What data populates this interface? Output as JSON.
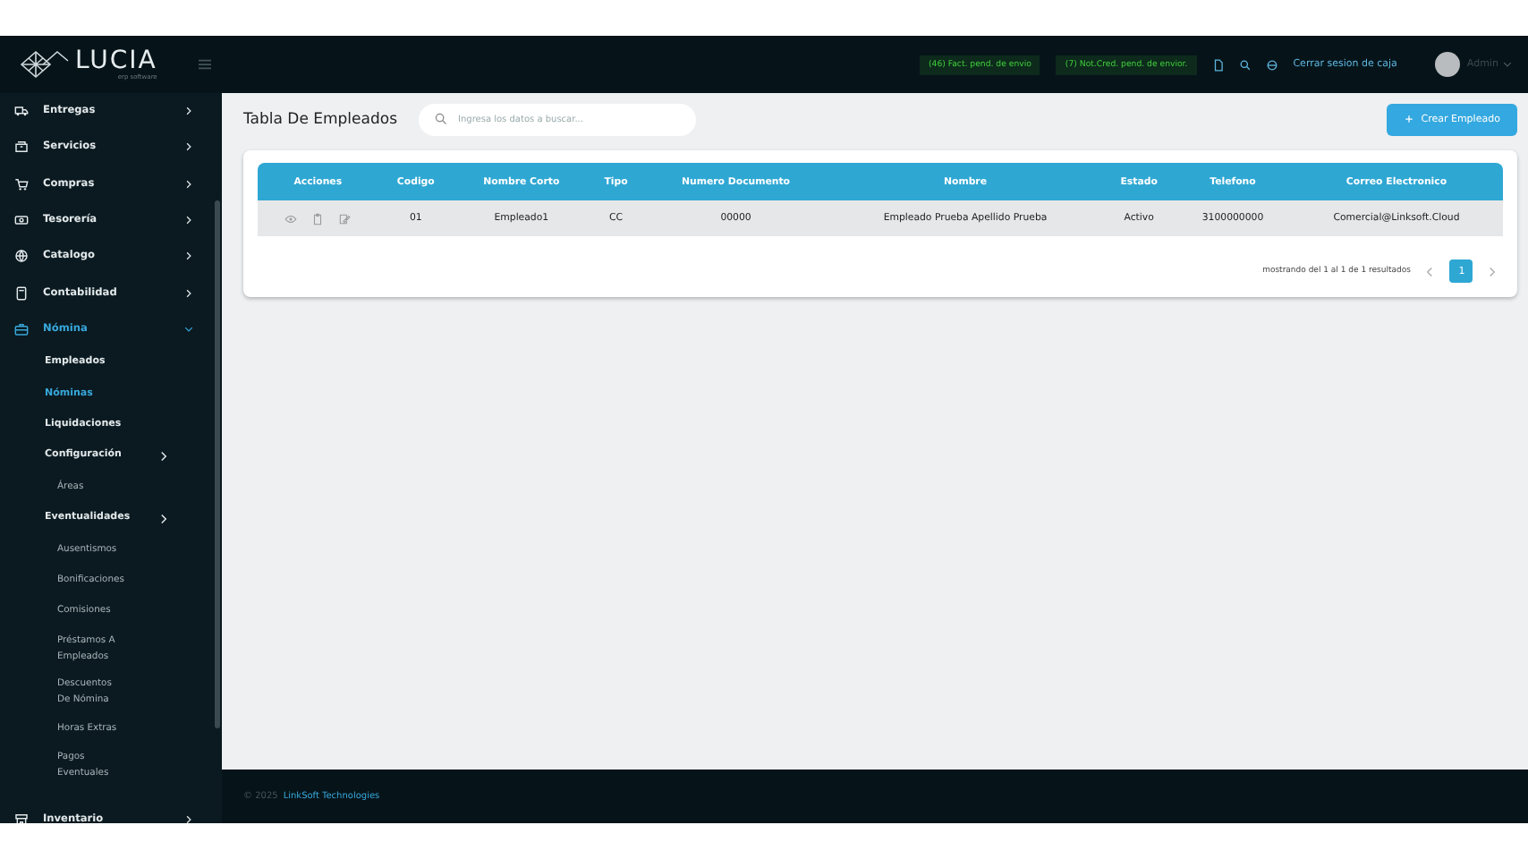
{
  "logo": {
    "name": "LUCIA",
    "tagline": "erp software"
  },
  "topbar": {
    "badges": [
      "(46) Fact. pend. de envio",
      "(7) Not.Cred. pend. de envior."
    ],
    "link": "Cerrar sesion de caja",
    "user": "Admin"
  },
  "sidebar": {
    "items": [
      {
        "label": "Entregas",
        "expanded": false,
        "selected": false
      },
      {
        "label": "Servicios",
        "expanded": false,
        "selected": false
      },
      {
        "label": "Compras",
        "expanded": false,
        "selected": false
      },
      {
        "label": "Tesorería",
        "expanded": false,
        "selected": false
      },
      {
        "label": "Catalogo",
        "expanded": false,
        "selected": false
      },
      {
        "label": "Contabilidad",
        "expanded": false,
        "selected": false
      },
      {
        "label": "Nómina",
        "expanded": true,
        "selected": true,
        "children": [
          {
            "label": "Empleados",
            "selected": false
          },
          {
            "label": "Nóminas",
            "selected": true
          },
          {
            "label": "Liquidaciones",
            "selected": false
          },
          {
            "label": "Configuración",
            "selected": false,
            "children": [
              {
                "label": "Áreas",
                "selected": false
              }
            ]
          },
          {
            "label": "Eventualidades",
            "selected": false,
            "children": [
              {
                "label": "Ausentismos",
                "selected": false
              },
              {
                "label": "Bonificaciones",
                "selected": false
              },
              {
                "label": "Comisiones",
                "selected": false
              },
              {
                "label": "Préstamos A Empleados",
                "selected": false
              },
              {
                "label": "Descuentos De Nómina",
                "selected": false
              },
              {
                "label": "Horas Extras",
                "selected": false
              },
              {
                "label": "Pagos Eventuales",
                "selected": false
              }
            ]
          }
        ]
      },
      {
        "label": "Inventario",
        "expanded": false,
        "selected": false
      }
    ]
  },
  "page": {
    "title": "Tabla De Empleados",
    "search": {
      "placeholder": "Ingresa los datos a buscar..."
    },
    "create_button": "Crear Empleado"
  },
  "table": {
    "columns": [
      "Acciones",
      "Codigo",
      "Nombre Corto",
      "Tipo",
      "Numero Documento",
      "Nombre",
      "Estado",
      "Telefono",
      "Correo Electronico"
    ],
    "rows": [
      [
        "",
        "01",
        "Empleado1",
        "CC",
        "00000",
        "Empleado Prueba Apellido Prueba",
        "Activo",
        "3100000000",
        "Comercial@Linksoft.Cloud"
      ]
    ]
  },
  "pagination": {
    "summary": "mostrando del 1 al 1 de 1 resultados",
    "pages": [
      {
        "label": "1",
        "selected": true
      }
    ]
  },
  "footer": {
    "year": "© 2025",
    "company": "LinkSoft Technologies"
  }
}
